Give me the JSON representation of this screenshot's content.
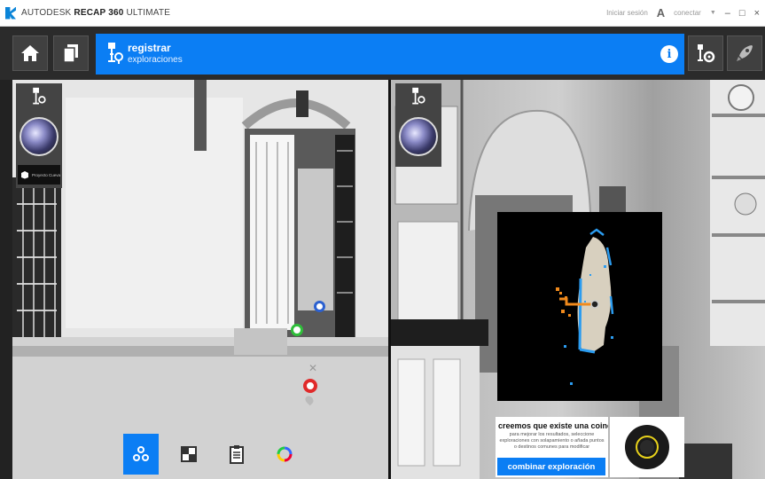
{
  "window": {
    "title_prefix": "AUTODESK",
    "title_bold": "RECAP 360",
    "title_suffix": "ULTIMATE",
    "signin": "Iniciar sesión",
    "connect": "conectar",
    "controls": [
      "–",
      "□",
      "×"
    ]
  },
  "header": {
    "title": "registrar",
    "subtitle": "exploraciones"
  },
  "left_view": {
    "thumb_label": "Proyecto Cueva"
  },
  "merge_card": {
    "heading": "creemos que existe una coinci...",
    "body": "para mejorar los resultados, seleccione exploraciones con solapamiento o añada puntos o destinos comunes para modificar",
    "button": "combinar exploración"
  },
  "colors": {
    "accent": "#0b7ef4",
    "titlebar": "#ffffff",
    "topbar": "#2b2b2b",
    "marker_green": "#2fbf3a",
    "marker_red": "#e02a2a",
    "map_orange": "#f08a1c",
    "map_blue": "#2b9cf0"
  },
  "icons": [
    "home-icon",
    "documents-icon",
    "register-scan-icon",
    "info-icon",
    "settings-scan-icon",
    "rocket-icon",
    "cluster-icon",
    "checker-icon",
    "clipboard-icon",
    "color-wheel-icon"
  ]
}
